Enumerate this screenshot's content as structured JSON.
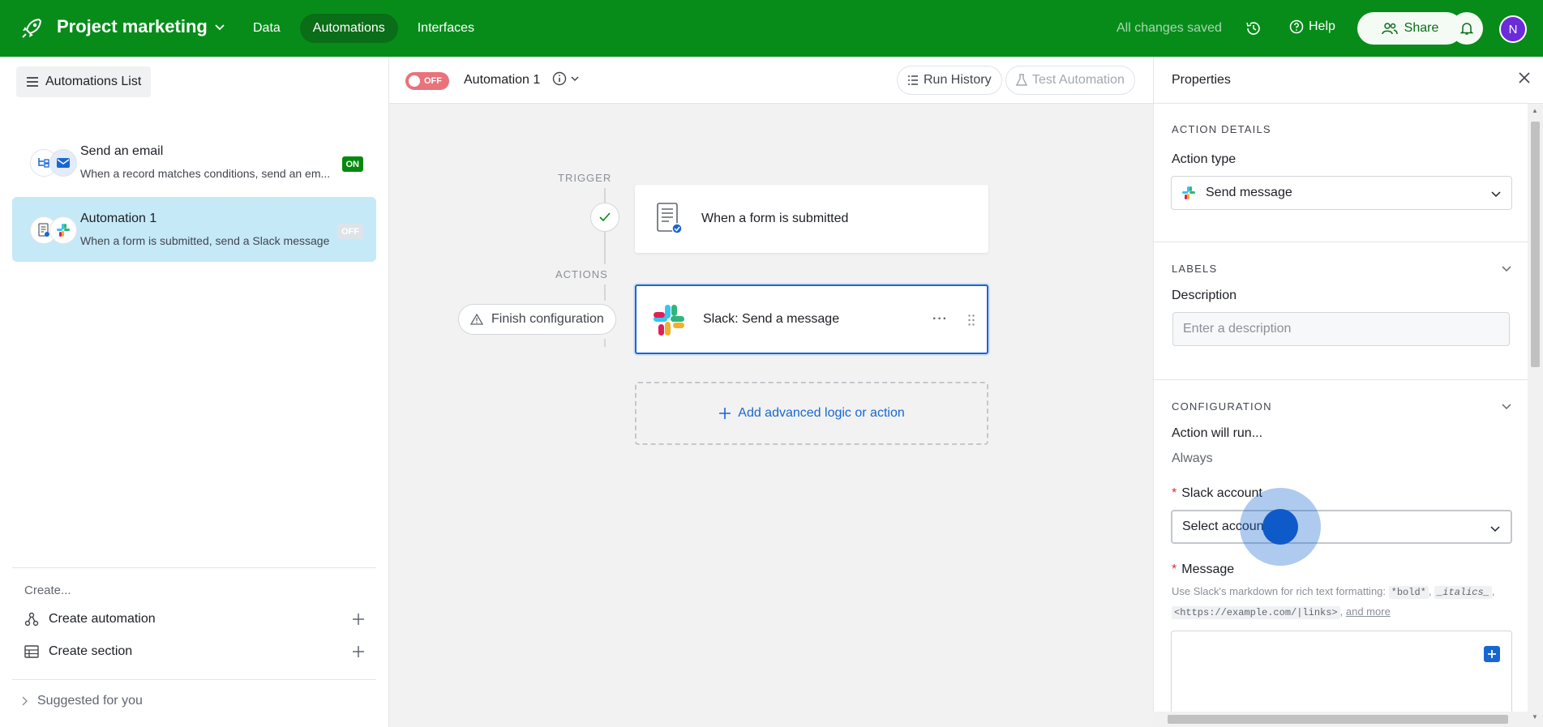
{
  "topbar": {
    "project_title": "Project marketing",
    "nav": [
      "Data",
      "Automations",
      "Interfaces"
    ],
    "active_nav": "Automations",
    "status": "All changes saved",
    "help": "Help",
    "share": "Share",
    "avatar_initial": "N",
    "bg_color": "#078c1a"
  },
  "sidebar": {
    "list_button": "Automations List",
    "automations": [
      {
        "name": "Send an email",
        "desc": "When a record matches conditions, send an em...",
        "badge": "ON"
      },
      {
        "name": "Automation 1",
        "desc": "When a form is submitted, send a Slack message",
        "badge": "OFF"
      }
    ],
    "create_label": "Create...",
    "create_automation": "Create automation",
    "create_section": "Create section",
    "suggested": "Suggested for you"
  },
  "canvas": {
    "toggle_label": "OFF",
    "automation_name": "Automation 1",
    "run_history": "Run History",
    "test_automation": "Test Automation",
    "trigger_label": "TRIGGER",
    "actions_label": "ACTIONS",
    "trigger_card": "When a form is submitted",
    "action_card": "Slack: Send a message",
    "finish_config": "Finish configuration",
    "add_logic": "Add advanced logic or action",
    "more": "···"
  },
  "properties": {
    "title": "Properties",
    "action_details": "ACTION DETAILS",
    "action_type_label": "Action type",
    "action_type_value": "Send message",
    "labels_section": "LABELS",
    "description_label": "Description",
    "description_placeholder": "Enter a description",
    "configuration_section": "CONFIGURATION",
    "action_will_run": "Action will run...",
    "always": "Always",
    "slack_account_label": "Slack account",
    "slack_account_value": "Select account",
    "message_label": "Message",
    "hint_prefix": "Use Slack's markdown for rich text formatting:",
    "hint_bold": "*bold*",
    "hint_italics": "_italics_",
    "hint_link": "<https://example.com/|links>",
    "hint_more": "and more",
    "required_mark": "*"
  }
}
